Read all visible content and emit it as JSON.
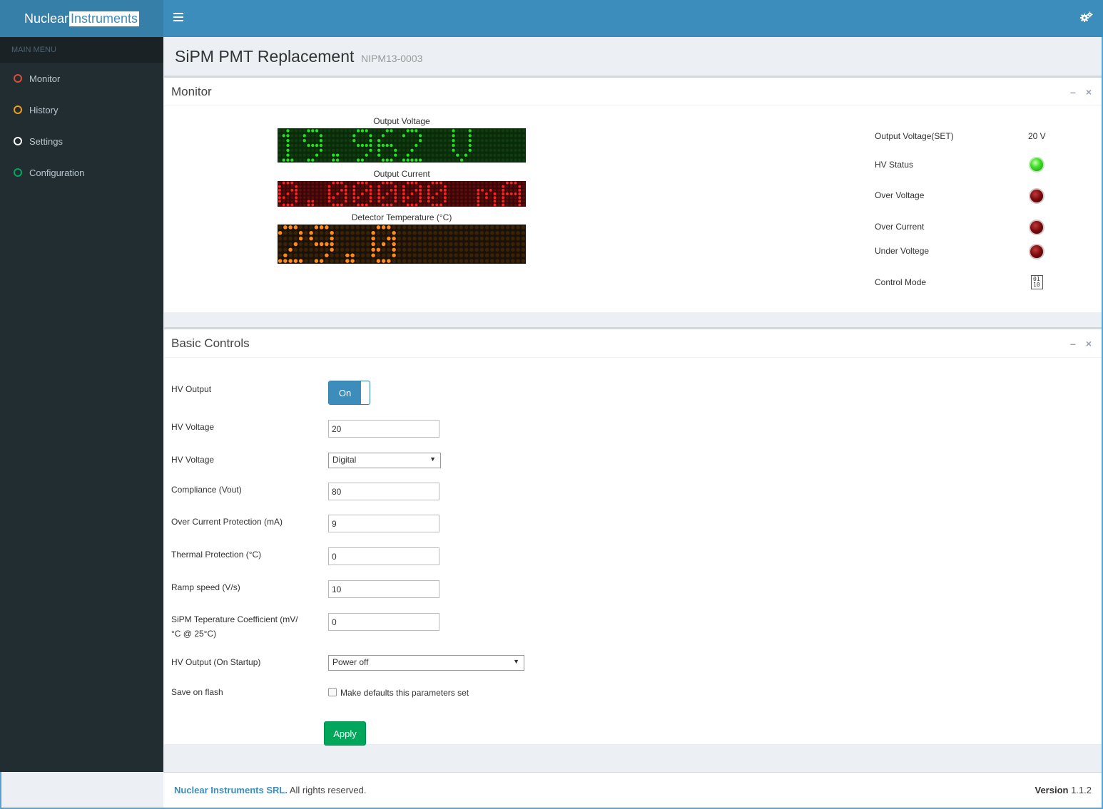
{
  "header": {
    "logo_part1": "Nuclear",
    "logo_part2": "Instruments",
    "menu_icon": "hamburger-icon",
    "settings_icon": "gears-icon"
  },
  "sidebar": {
    "header": "MAIN MENU",
    "items": [
      {
        "label": "Monitor",
        "color": "#dd4b39"
      },
      {
        "label": "History",
        "color": "#f39c12"
      },
      {
        "label": "Settings",
        "color": "#ffffff"
      },
      {
        "label": "Configuration",
        "color": "#00a65a"
      }
    ]
  },
  "page": {
    "title": "SiPM PMT Replacement",
    "subtitle": "NIPM13-0003"
  },
  "monitor": {
    "title": "Monitor",
    "displays": [
      {
        "label": "Output Voltage",
        "value": "19.962 V",
        "color": "#22e022",
        "off_color": "#0f3d0f",
        "bg": "#0a2a0a"
      },
      {
        "label": "Output Current",
        "value": "0.00000 mA",
        "color": "#ff2020",
        "off_color": "#5a0d0d",
        "bg": "#3a0606"
      },
      {
        "label": "Detector Temperature (°C)",
        "value": "29.0",
        "color": "#ff8c1a",
        "off_color": "#3a2208",
        "bg": "#1a1208"
      }
    ],
    "status": {
      "output_voltage_set_label": "Output Voltage(SET)",
      "output_voltage_set_value": "20 V",
      "hv_status_label": "HV Status",
      "over_voltage_label": "Over Voltage",
      "over_current_label": "Over Current",
      "under_voltage_label": "Under Voltege",
      "control_mode_label": "Control Mode",
      "control_mode_icon_text": "01 10",
      "control_mode_icon": "binary-chip-icon"
    }
  },
  "controls": {
    "title": "Basic Controls",
    "hv_output_label": "HV Output",
    "hv_output_state": "On",
    "hv_voltage_label": "HV Voltage",
    "hv_voltage_value": "20",
    "hv_voltage_mode_label": "HV Voltage",
    "hv_voltage_mode_value": "Digital",
    "compliance_label": "Compliance (Vout)",
    "compliance_value": "80",
    "ocp_label": "Over Current Protection (mA)",
    "ocp_value": "9",
    "thermal_label": "Thermal Protection (°C)",
    "thermal_value": "0",
    "ramp_label": "Ramp speed (V/s)",
    "ramp_value": "10",
    "tempco_label_line1": "SiPM Teperature Coefficient (mV/",
    "tempco_label_line2": "°C @ 25°C)",
    "tempco_value": "0",
    "startup_label": "HV Output (On Startup)",
    "startup_value": "Power off",
    "save_label": "Save on flash",
    "save_checkbox_label": "Make defaults this parameters set",
    "apply_label": "Apply"
  },
  "footer": {
    "company": "Nuclear Instruments SRL.",
    "rights": " All rights reserved.",
    "version_label": "Version",
    "version_value": "1.1.2"
  }
}
